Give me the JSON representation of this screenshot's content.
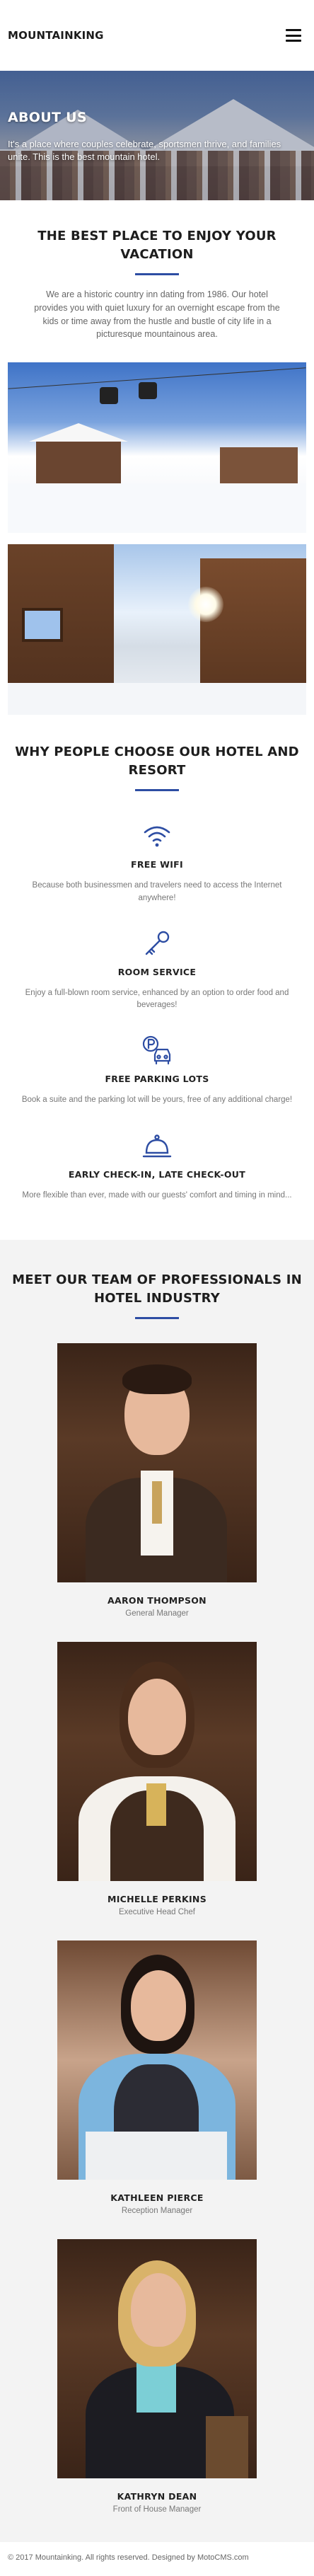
{
  "header": {
    "logo": "MOUNTAINKING",
    "menu_icon": "hamburger-icon"
  },
  "hero": {
    "title": "ABOUT US",
    "subtitle": "It's a place where couples celebrate, sportsmen thrive, and families unite. This is the best mountain hotel."
  },
  "about": {
    "title": "THE BEST PLACE TO ENJOY YOUR VACATION",
    "text": "We are a historic country inn dating from 1986. Our hotel provides you with quiet luxury for an overnight escape from the kids or time away from the hustle and bustle of city life in a picturesque mountainous area."
  },
  "why": {
    "title": "WHY PEOPLE CHOOSE OUR HOTEL AND RESORT",
    "features": [
      {
        "icon": "wifi-icon",
        "title": "FREE WIFI",
        "text": "Because both businessmen and travelers need to access the Internet anywhere!"
      },
      {
        "icon": "key-icon",
        "title": "ROOM SERVICE",
        "text": "Enjoy a full-blown room service, enhanced by an option to order food and beverages!"
      },
      {
        "icon": "parking-icon",
        "title": "FREE PARKING LOTS",
        "text": "Book a suite and the parking lot will be yours, free of any additional charge!"
      },
      {
        "icon": "bell-icon",
        "title": "EARLY CHECK-IN, LATE CHECK-OUT",
        "text": "More flexible than ever, made with our guests' comfort and timing in mind..."
      }
    ]
  },
  "team": {
    "title": "MEET OUR TEAM OF PROFESSIONALS IN HOTEL INDUSTRY",
    "members": [
      {
        "name": "AARON THOMPSON",
        "role": "General Manager"
      },
      {
        "name": "MICHELLE PERKINS",
        "role": "Executive Head Chef"
      },
      {
        "name": "KATHLEEN PIERCE",
        "role": "Reception Manager"
      },
      {
        "name": "KATHRYN DEAN",
        "role": "Front of House Manager"
      }
    ]
  },
  "footer": {
    "text": "© 2017 Mountainking. All rights reserved. Designed by MotoCMS.com"
  },
  "colors": {
    "accent": "#2d4da3",
    "icon": "#2d4da3",
    "team_bg": "#f3f3f3"
  }
}
